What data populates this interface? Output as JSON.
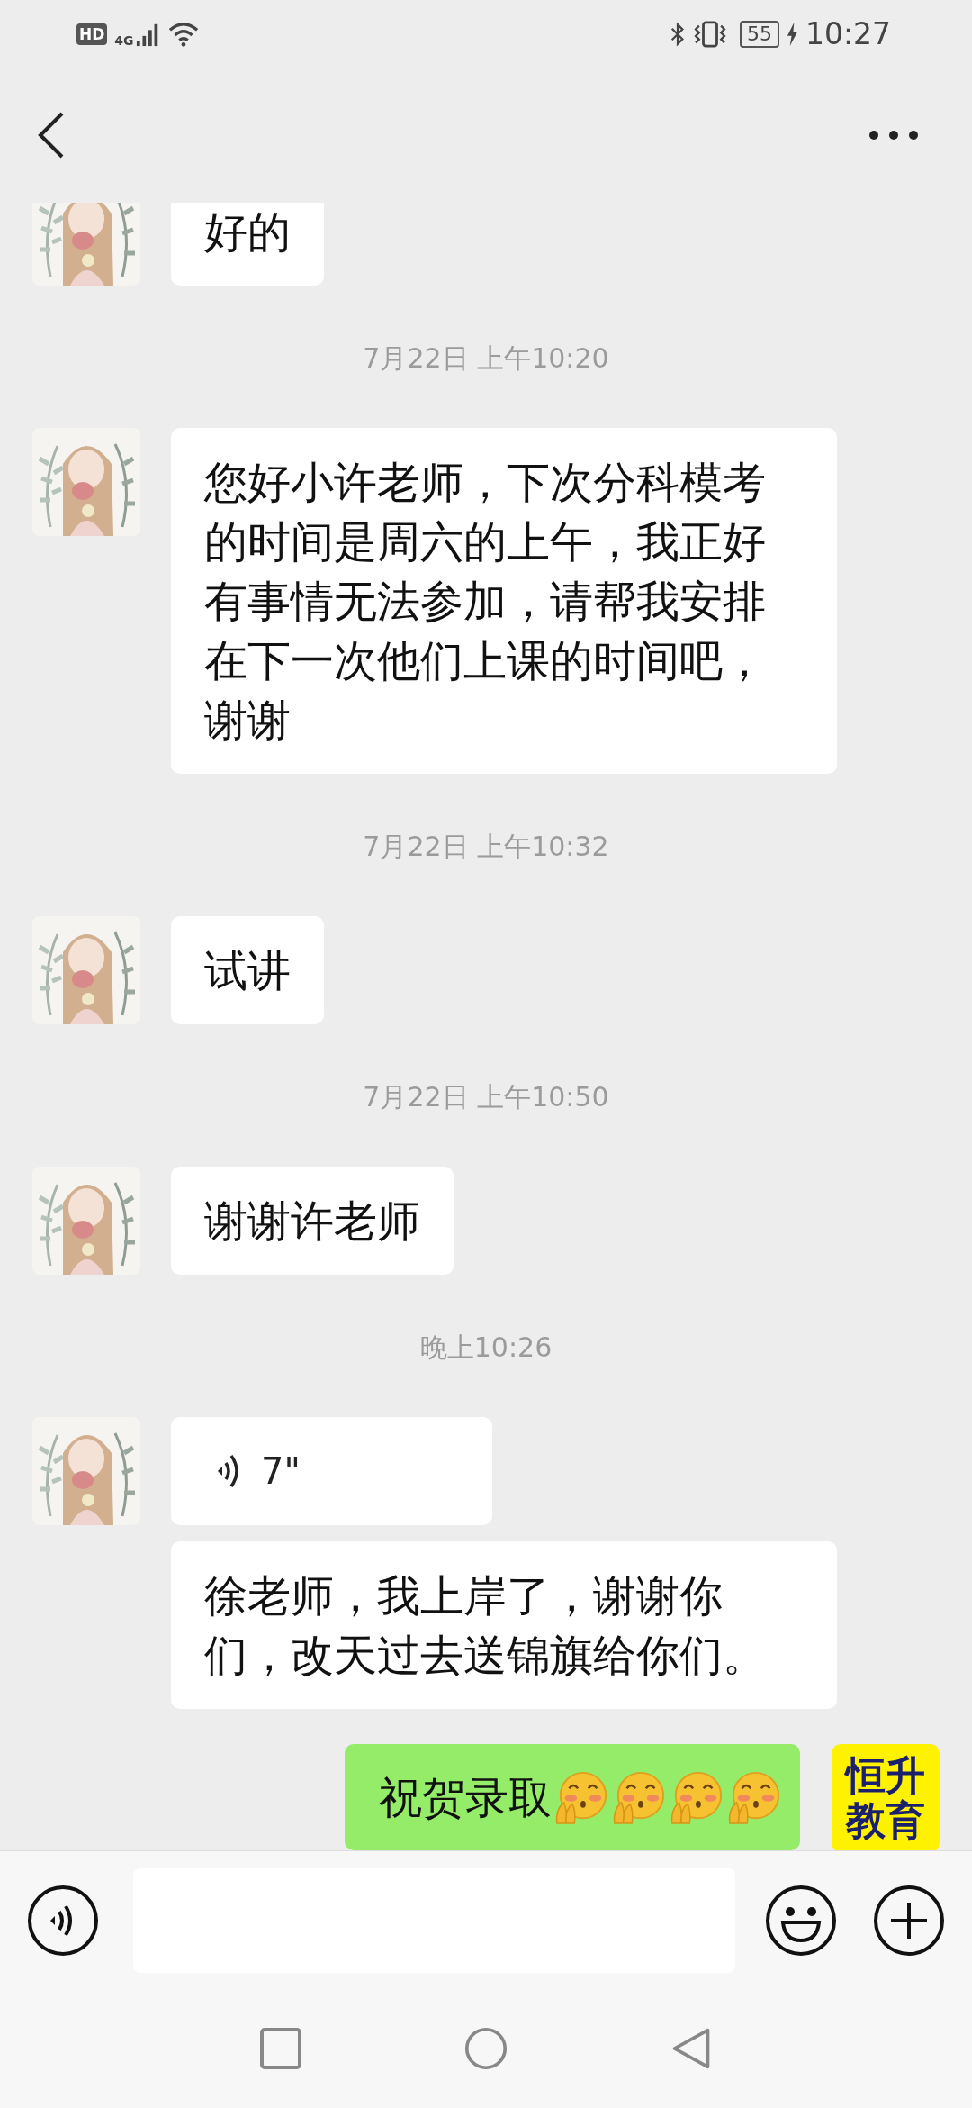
{
  "status_bar": {
    "hd_badge": "HD",
    "network": "4G",
    "battery": "55",
    "time": "10:27"
  },
  "messages": [
    {
      "kind": "incoming",
      "avatar": true,
      "text": "好的"
    },
    {
      "kind": "time",
      "text": "7月22日 上午10:20"
    },
    {
      "kind": "incoming",
      "avatar": true,
      "text": "您好小许老师，下次分科模考的时间是周六的上午，我正好有事情无法参加，请帮我安排在下一次他们上课的时间吧，谢谢"
    },
    {
      "kind": "time",
      "text": "7月22日 上午10:32"
    },
    {
      "kind": "incoming",
      "avatar": true,
      "text": "试讲"
    },
    {
      "kind": "time",
      "text": "7月22日 上午10:50"
    },
    {
      "kind": "incoming",
      "avatar": true,
      "text": "谢谢许老师"
    },
    {
      "kind": "time",
      "text": "晚上10:26"
    },
    {
      "kind": "incoming_voice",
      "avatar": true,
      "duration": "7\""
    },
    {
      "kind": "incoming",
      "avatar": false,
      "text": "徐老师，我上岸了，谢谢你们，改天过去送锦旗给你们。"
    },
    {
      "kind": "outgoing",
      "avatar": true,
      "text": "祝贺录取",
      "emojis": [
        {
          "kind": "covering-mouth"
        },
        {
          "kind": "covering-mouth"
        },
        {
          "kind": "covering-mouth"
        },
        {
          "kind": "covering-mouth"
        }
      ]
    }
  ],
  "my_avatar": {
    "lines": [
      "恒升",
      "教育"
    ]
  }
}
